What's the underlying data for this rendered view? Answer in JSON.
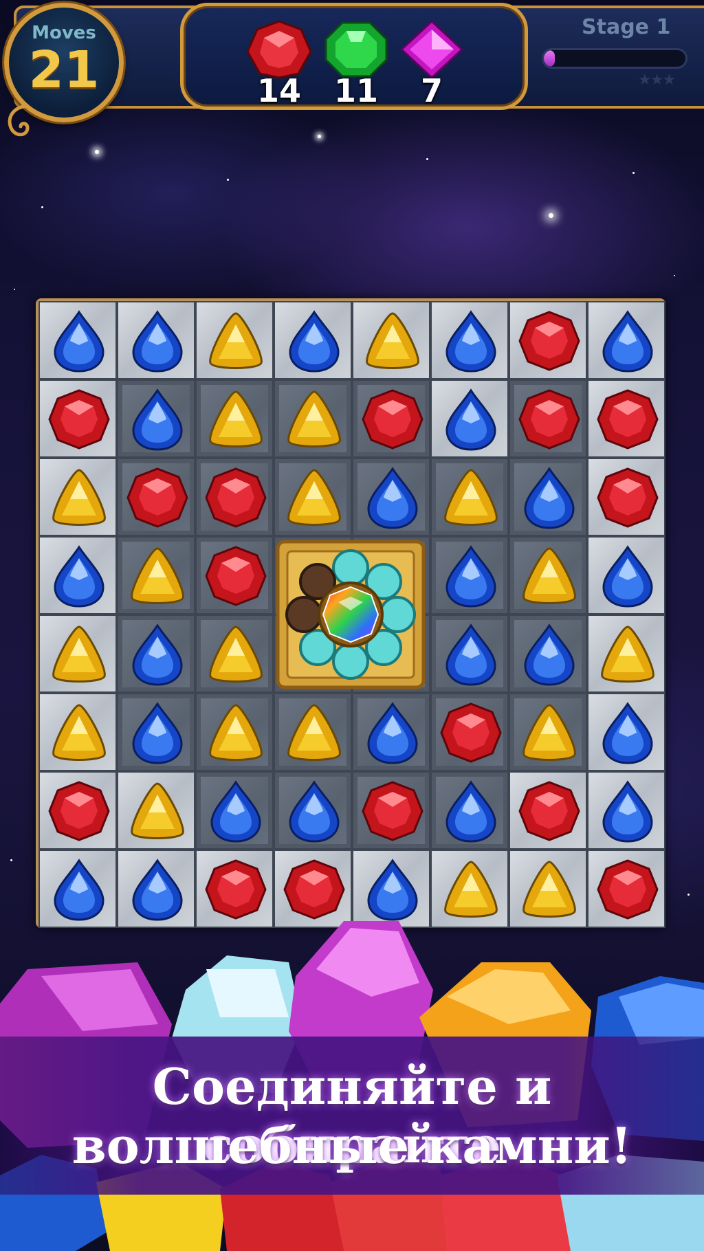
{
  "hud": {
    "moves_label": "Moves",
    "moves_value": "21",
    "stage_label": "Stage 1",
    "stage_progress": 0.08,
    "stars_earned": 0,
    "stars_total": 3,
    "goals": [
      {
        "gem": "red",
        "count": "14"
      },
      {
        "gem": "green",
        "count": "11"
      },
      {
        "gem": "pink",
        "count": "7"
      }
    ]
  },
  "board": {
    "size": 8,
    "tile_pattern": [
      "LLLLLLLL",
      "LDDDDLDL",
      "LDDDDDDL",
      "LDDDDDDL",
      "LDDDDDDL",
      "LDDDDDDL",
      "LLDDDDLL",
      "LLLLLLLL"
    ],
    "gems": [
      [
        "blue",
        "blue",
        "yellow",
        "blue",
        "yellow",
        "blue",
        "red",
        "blue"
      ],
      [
        "red",
        "blue",
        "yellow",
        "yellow",
        "red",
        "blue",
        "red",
        "red"
      ],
      [
        "yellow",
        "red",
        "red",
        "yellow",
        "blue",
        "yellow",
        "blue",
        "red"
      ],
      [
        "blue",
        "yellow",
        "red",
        "",
        "",
        "blue",
        "yellow",
        "blue"
      ],
      [
        "yellow",
        "blue",
        "yellow",
        "",
        "",
        "blue",
        "blue",
        "yellow"
      ],
      [
        "yellow",
        "blue",
        "yellow",
        "yellow",
        "blue",
        "red",
        "yellow",
        "blue"
      ],
      [
        "red",
        "yellow",
        "blue",
        "blue",
        "red",
        "blue",
        "red",
        "blue"
      ],
      [
        "blue",
        "blue",
        "red",
        "red",
        "blue",
        "yellow",
        "yellow",
        "red"
      ]
    ],
    "booster": "rainbow-gem-bomb"
  },
  "promo": {
    "line1": "Соединяйте и собирайте",
    "line2": "волшебные камни!"
  },
  "colors": {
    "gold_frame": "#d19a3e",
    "hud_bg": "#0f1a3c",
    "promo_bg": "#461482",
    "progress_fill": "#c84ae0"
  }
}
